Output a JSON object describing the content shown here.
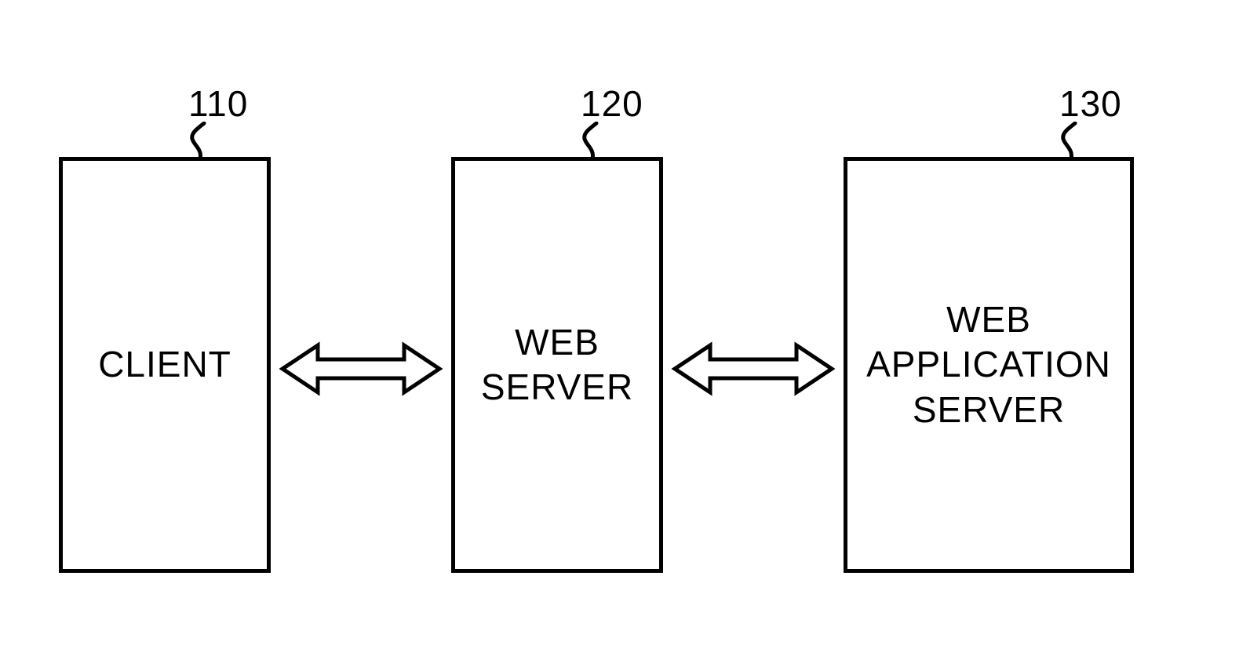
{
  "boxes": {
    "client": {
      "ref": "110",
      "label": "CLIENT"
    },
    "webserver": {
      "ref": "120",
      "label": "WEB\nSERVER"
    },
    "appserver": {
      "ref": "130",
      "label": "WEB\nAPPLICATION\nSERVER"
    }
  }
}
